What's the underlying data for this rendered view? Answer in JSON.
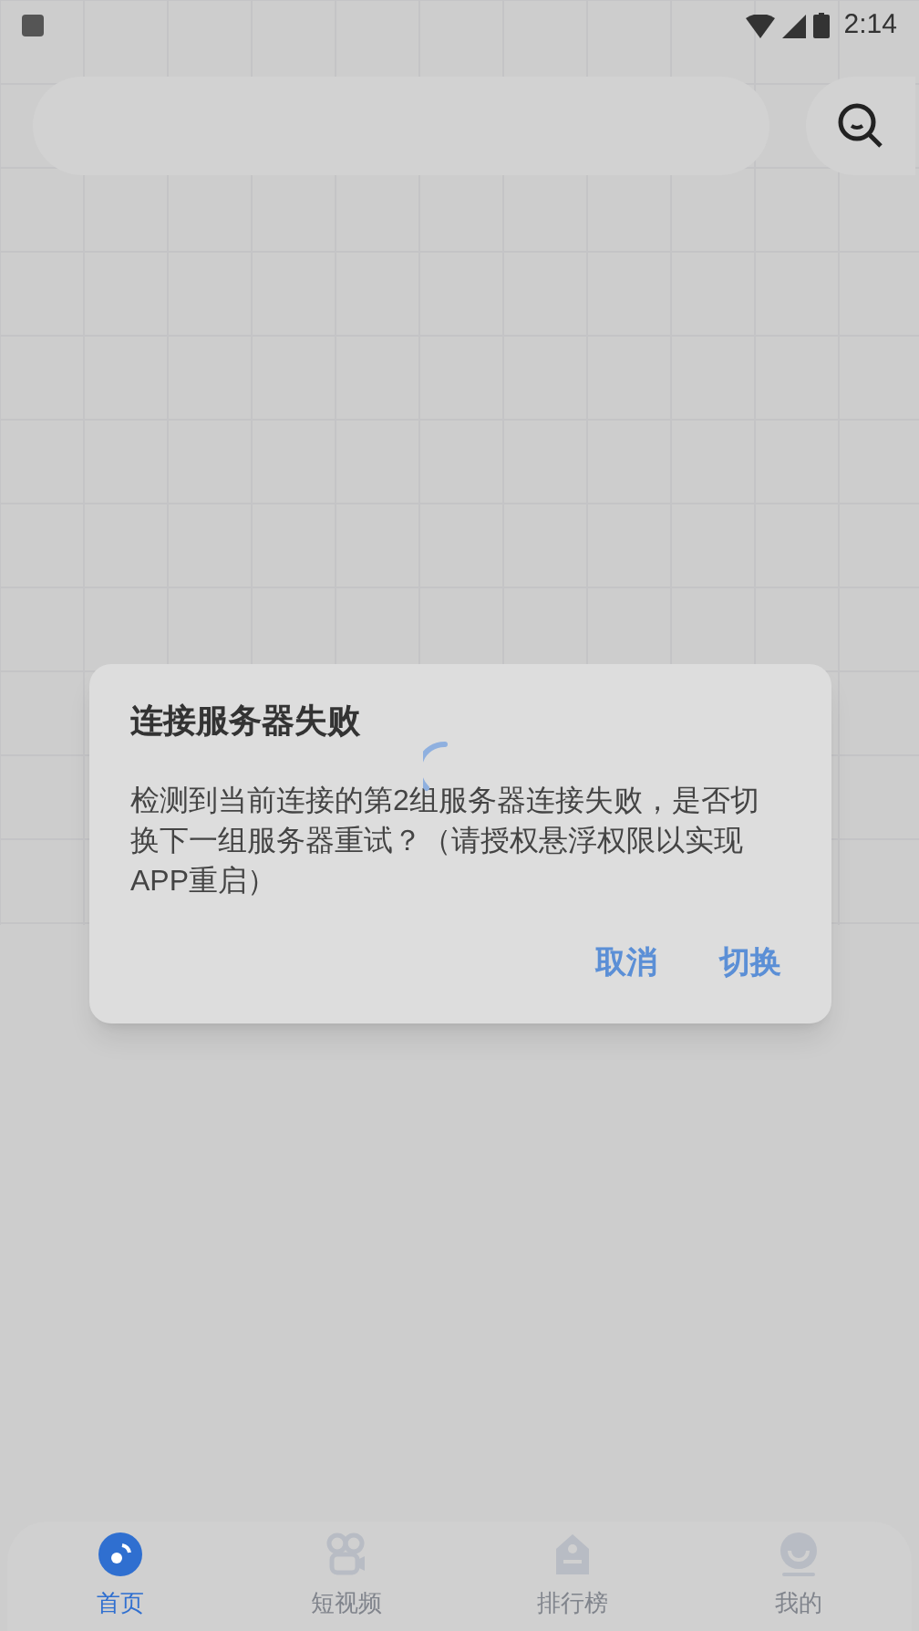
{
  "status_bar": {
    "time": "2:14"
  },
  "dialog": {
    "title": "连接服务器失败",
    "message": "检测到当前连接的第2组服务器连接失败，是否切换下一组服务器重试？（请授权悬浮权限以实现APP重启）",
    "buttons": [
      "取消",
      "切换"
    ]
  },
  "bottom_nav": [
    {
      "label": "首页",
      "kind": "home",
      "selected": true
    },
    {
      "label": "短视频",
      "kind": "video",
      "selected": false
    },
    {
      "label": "排行榜",
      "kind": "rank",
      "selected": false
    },
    {
      "label": "我的",
      "kind": "me",
      "selected": false
    }
  ]
}
